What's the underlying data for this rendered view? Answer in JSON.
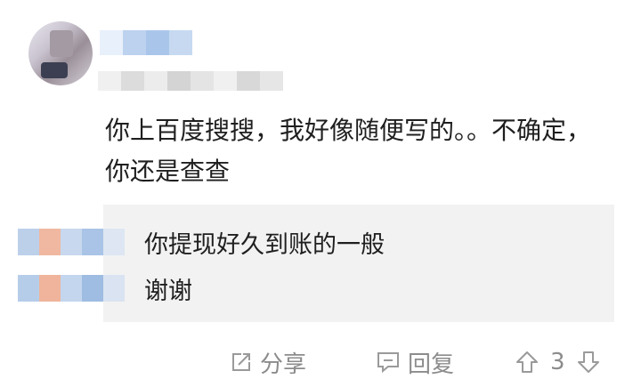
{
  "comment": {
    "text": "你上百度搜搜，我好像随便写的。。不确定，你还是查查"
  },
  "replies": [
    {
      "text": "你提现好久到账的一般"
    },
    {
      "text": "谢谢"
    }
  ],
  "actions": {
    "share_label": "分享",
    "reply_label": "回复",
    "vote_count": "3"
  },
  "icons": {
    "share": "share-icon",
    "reply": "reply-icon",
    "upvote": "upvote-arrow-icon",
    "downvote": "downvote-arrow-icon"
  }
}
